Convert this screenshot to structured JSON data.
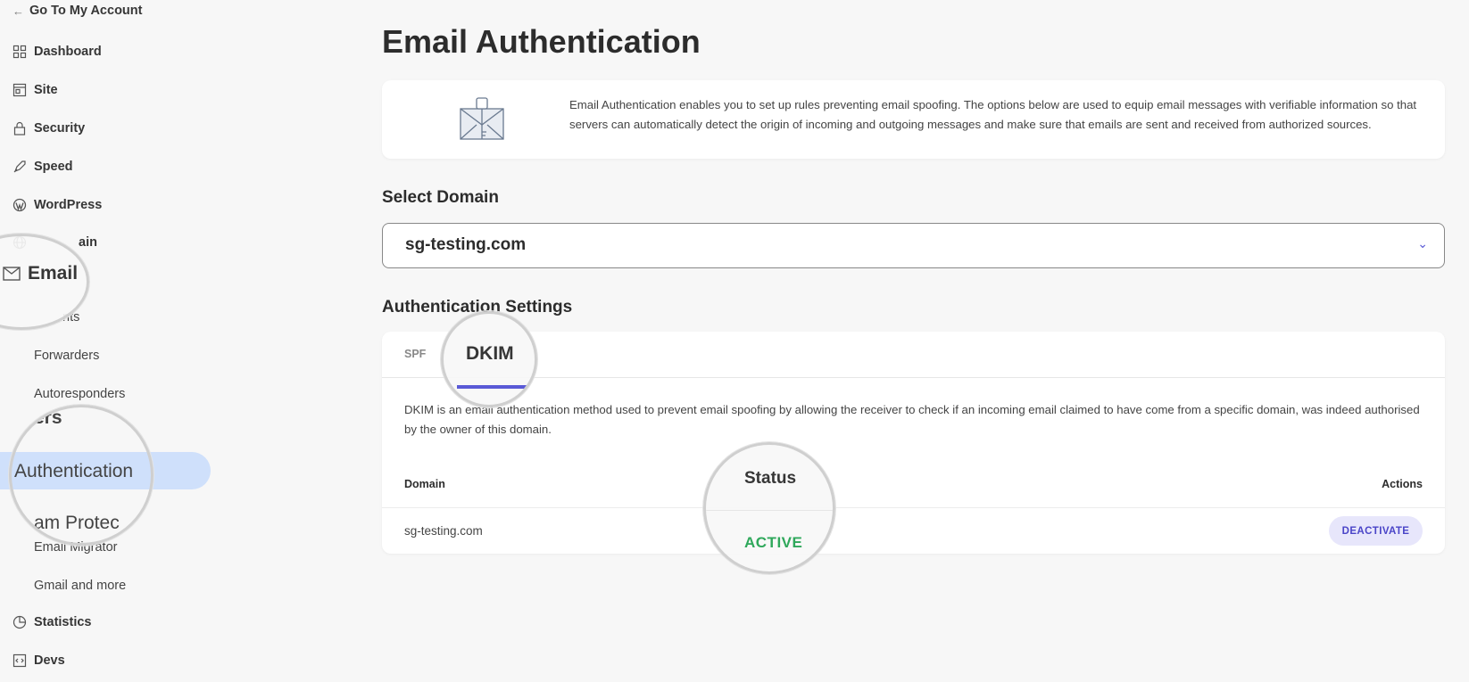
{
  "sidebar": {
    "back_label": "Go To My Account",
    "items": [
      {
        "label": "Dashboard",
        "icon": "grid-icon"
      },
      {
        "label": "Site",
        "icon": "site-icon"
      },
      {
        "label": "Security",
        "icon": "lock-icon"
      },
      {
        "label": "Speed",
        "icon": "rocket-icon"
      },
      {
        "label": "WordPress",
        "icon": "wordpress-icon"
      },
      {
        "label": "Domain",
        "icon": "globe-icon"
      },
      {
        "label": "Email",
        "icon": "envelope-icon"
      },
      {
        "label": "Statistics",
        "icon": "pie-chart-icon"
      },
      {
        "label": "Devs",
        "icon": "code-icon"
      }
    ],
    "domain_partial": "ain",
    "email_subitems": {
      "accounts_partial": "nts",
      "forwarders": "Forwarders",
      "autoresponders": "Autoresponders",
      "filters_partial": "ers",
      "authentication": "Authentication",
      "spam_partial": "am Protec",
      "email_migrator": "Email Migrator",
      "gmail": "Gmail and more"
    }
  },
  "main": {
    "title": "Email Authentication",
    "info_text": "Email Authentication enables you to set up rules preventing email spoofing. The options below are used to equip email messages with verifiable information so that servers can automatically detect the origin of incoming and outgoing messages and make sure that emails are sent and received from authorized sources.",
    "select_domain_label": "Select Domain",
    "selected_domain": "sg-testing.com",
    "auth_settings_label": "Authentication Settings",
    "tabs": [
      {
        "label": "SPF"
      },
      {
        "label": "DKIM",
        "active": true
      }
    ],
    "dkim_description": "DKIM is an email authentication method used to prevent email spoofing by allowing the receiver to check if an incoming email claimed to have come from a specific domain, was indeed authorised by the owner of this domain.",
    "table": {
      "headers": {
        "domain": "Domain",
        "status": "Status",
        "actions": "Actions"
      },
      "rows": [
        {
          "domain": "sg-testing.com",
          "status": "ACTIVE",
          "action": "DEACTIVATE"
        }
      ]
    }
  },
  "colors": {
    "accent": "#5a5ad6",
    "active_pill": "#cfe0fb",
    "status_active": "#2fa85b",
    "button_bg": "#e7e6fb"
  }
}
